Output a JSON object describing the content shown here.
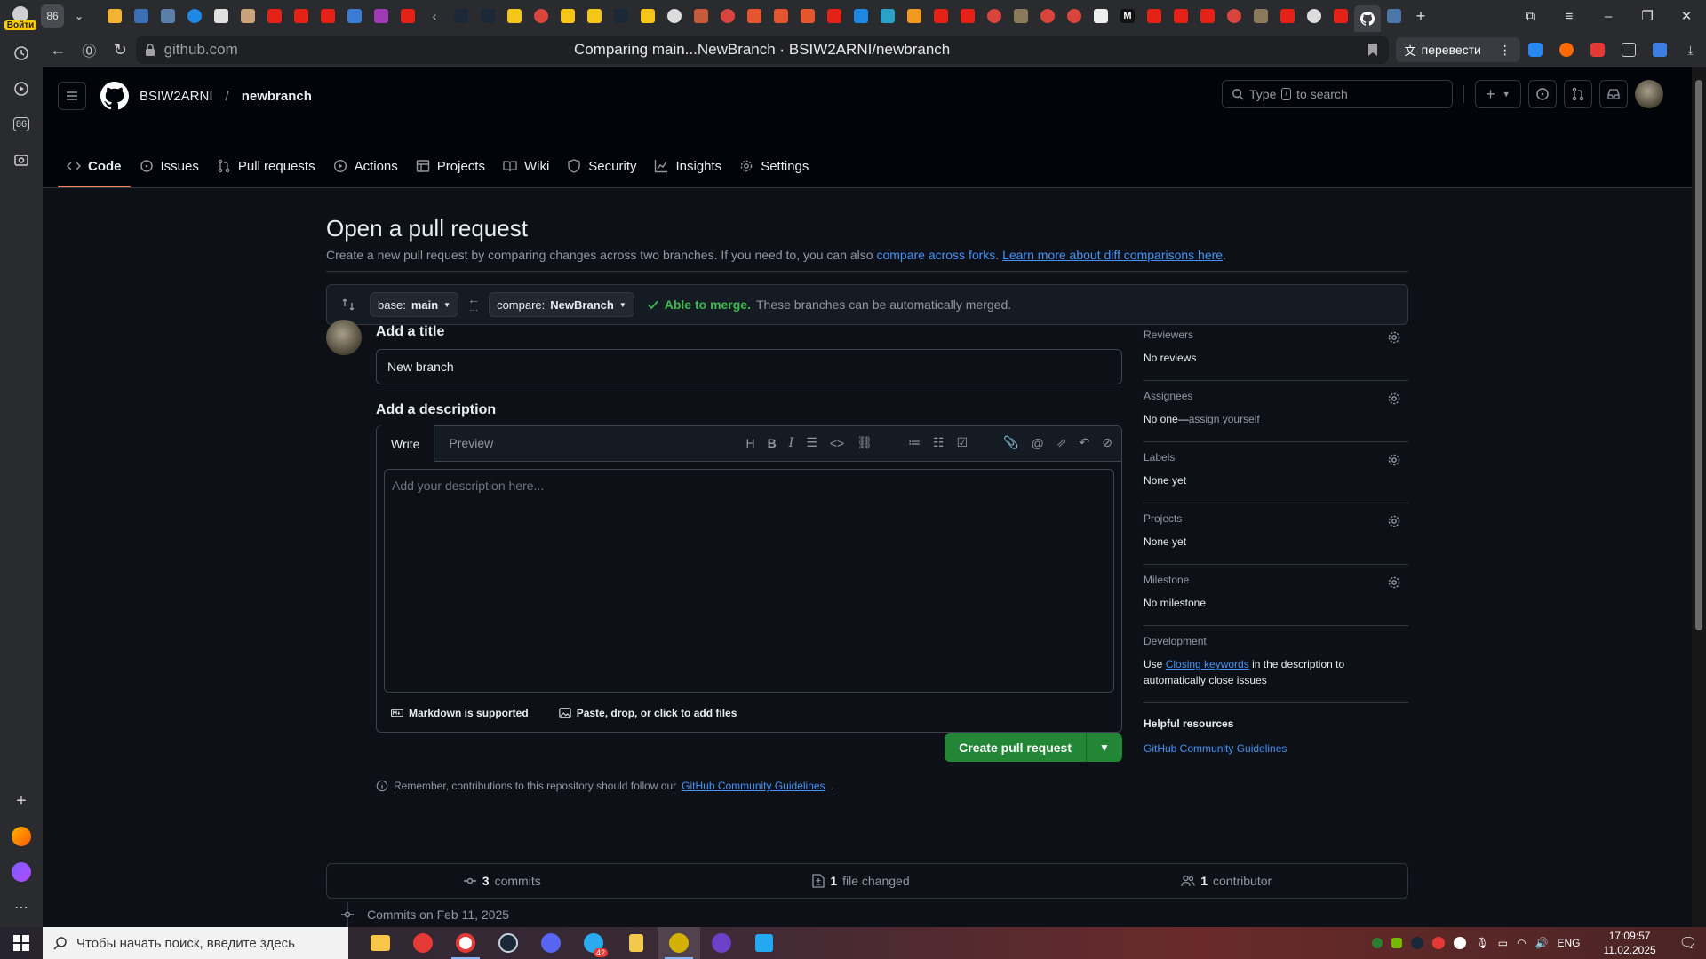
{
  "browser": {
    "login_badge": "Войти",
    "tab_count": "86",
    "url": "github.com",
    "title": "Comparing main...NewBranch · BSIW2ARNI/newbranch",
    "translate_label": "перевести"
  },
  "sidebar": {
    "badge": "86"
  },
  "gh": {
    "owner": "BSIW2ARNI",
    "repo": "newbranch",
    "search": {
      "prefix": "Type",
      "key": "/",
      "suffix": "to search"
    },
    "nav": [
      {
        "label": "Code",
        "icon": "code-icon"
      },
      {
        "label": "Issues",
        "icon": "issue-icon"
      },
      {
        "label": "Pull requests",
        "icon": "pull-request-icon"
      },
      {
        "label": "Actions",
        "icon": "play-icon"
      },
      {
        "label": "Projects",
        "icon": "table-icon"
      },
      {
        "label": "Wiki",
        "icon": "book-icon"
      },
      {
        "label": "Security",
        "icon": "shield-icon"
      },
      {
        "label": "Insights",
        "icon": "graph-icon"
      },
      {
        "label": "Settings",
        "icon": "gear-icon"
      }
    ]
  },
  "pr": {
    "heading": "Open a pull request",
    "subtitle_pre": "Create a new pull request by comparing changes across two branches. If you need to, you can also",
    "compare_forks": "compare across forks",
    "learn_more": "Learn more about diff comparisons here",
    "base_label": "base:",
    "base_value": "main",
    "compare_label": "compare:",
    "compare_value": "NewBranch",
    "merge_ok": "Able to merge.",
    "merge_desc": "These branches can be automatically merged.",
    "title_label": "Add a title",
    "title_value": "New branch",
    "desc_label": "Add a description",
    "tab_write": "Write",
    "tab_preview": "Preview",
    "desc_placeholder": "Add your description here...",
    "markdown_note": "Markdown is supported",
    "attach_note": "Paste, drop, or click to add files",
    "create_button": "Create pull request",
    "remember_pre": "Remember, contributions to this repository should follow our",
    "remember_link": "GitHub Community Guidelines"
  },
  "sidebar_panel": {
    "reviewers": {
      "title": "Reviewers",
      "value": "No reviews"
    },
    "assignees": {
      "title": "Assignees",
      "value": "No one—",
      "link": "assign yourself"
    },
    "labels": {
      "title": "Labels",
      "value": "None yet"
    },
    "projects": {
      "title": "Projects",
      "value": "None yet"
    },
    "milestone": {
      "title": "Milestone",
      "value": "No milestone"
    },
    "development": {
      "title": "Development",
      "pre": "Use",
      "link": "Closing keywords",
      "post": "in the description to automatically close issues"
    },
    "helpful": {
      "title": "Helpful resources",
      "link": "GitHub Community Guidelines"
    }
  },
  "stats": {
    "commits_count": "3",
    "commits_label": "commits",
    "files_count": "1",
    "files_label": "file changed",
    "contrib_count": "1",
    "contrib_label": "contributor"
  },
  "commits_on": "Commits on Feb 11, 2025",
  "taskbar": {
    "search_placeholder": "Чтобы начать поиск, введите здесь",
    "lang": "ENG",
    "time": "17:09:57",
    "date": "11.02.2025",
    "telegram_badge": "42"
  },
  "colors": {
    "accent": "#4493f8",
    "success": "#3fb950",
    "create": "#238636",
    "nav_underline": "#f78166"
  }
}
